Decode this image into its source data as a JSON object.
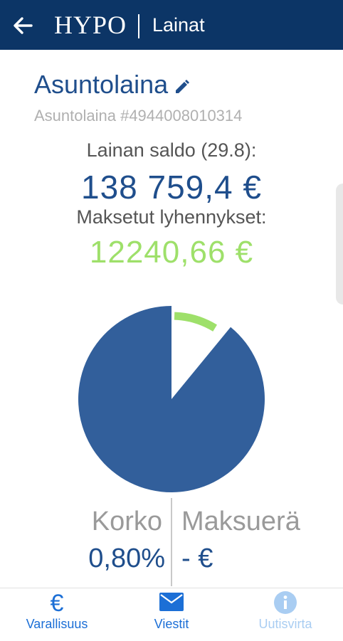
{
  "header": {
    "back_icon": "arrow-left-icon",
    "brand": "HYPO",
    "section": "Lainat"
  },
  "loan": {
    "title": "Asuntolaina",
    "edit_icon": "pencil-icon",
    "number": "Asuntolaina #4944008010314",
    "balance_label": "Lainan saldo (29.8):",
    "balance_value": "138 759,4 €",
    "paid_label": "Maksetut lyhennykset:",
    "paid_value": "12240,66 €",
    "paid_fraction": 0.081
  },
  "stats": {
    "interest_label": "Korko",
    "interest_value": "0,80%",
    "payment_label": "Maksuerä",
    "payment_value": "- €"
  },
  "colors": {
    "header_bg": "#0c3566",
    "primary": "#1f4e8c",
    "pie": "#325f9b",
    "accent_green": "#9ee06a",
    "muted": "#9a9a9a",
    "nav_active": "#1c6fd6",
    "nav_inactive": "#a9cdf2"
  },
  "nav": {
    "items": [
      {
        "label": "Varallisuus",
        "icon": "euro-icon"
      },
      {
        "label": "Viestit",
        "icon": "envelope-icon"
      },
      {
        "label": "Uutisvirta",
        "icon": "info-icon"
      }
    ]
  }
}
